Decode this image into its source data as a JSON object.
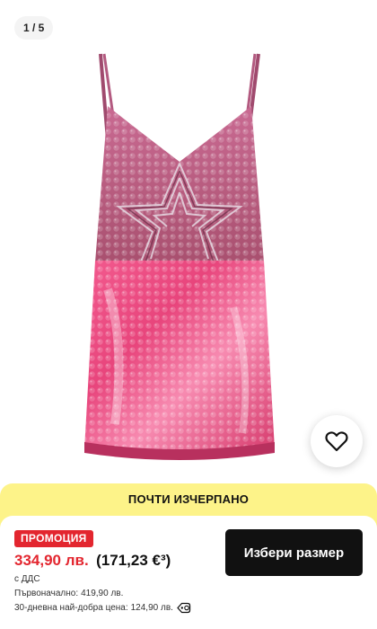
{
  "gallery": {
    "counter": "1 / 5"
  },
  "product": {
    "image_icon": "sequin-mini-dress-image"
  },
  "wishlist": {
    "icon": "heart-icon"
  },
  "stock": {
    "label": "ПОЧТИ ИЗЧЕРПАНО"
  },
  "pricing": {
    "promo_badge": "ПРОМОЦИЯ",
    "sale_price": "334,90 лв.",
    "sale_price_eur": "(171,23 €³)",
    "vat_note": "с ДДС",
    "original_label": "Първоначално:",
    "original_value": "419,90 лв.",
    "lowest_label": "30-дневна най-добра цена:",
    "lowest_value": "124,90 лв.",
    "lowest_info_icon": "price-tag-info-icon"
  },
  "cta": {
    "select_size_label": "Избери размер"
  },
  "colors": {
    "accent_red": "#e3262f",
    "banner_yellow": "#fdf389",
    "button_black": "#111111"
  }
}
